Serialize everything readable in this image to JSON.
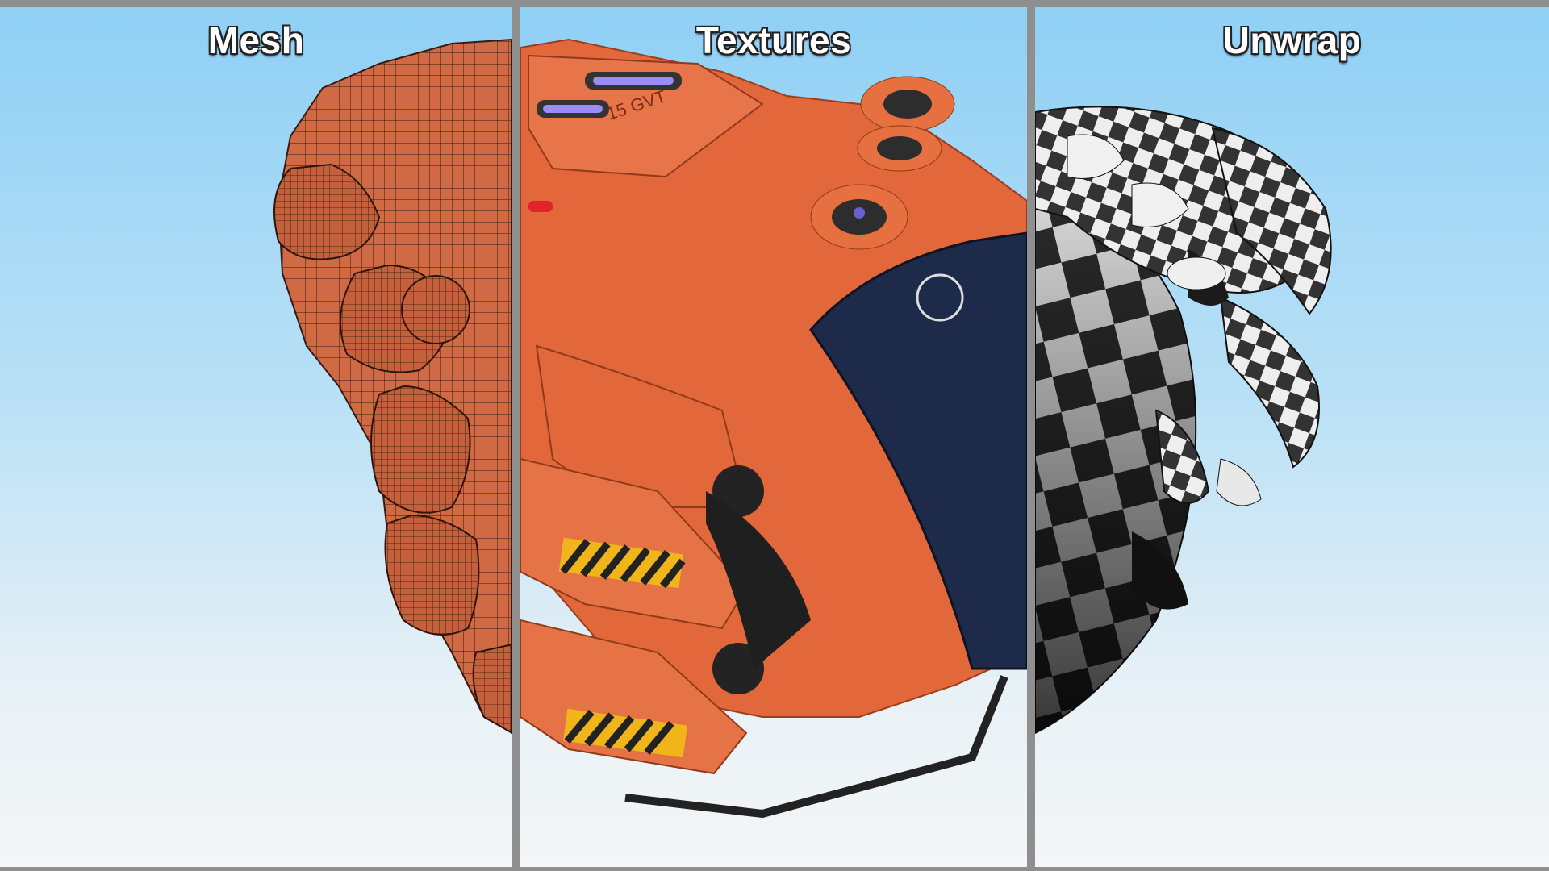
{
  "panels": [
    {
      "title": "Mesh"
    },
    {
      "title": "Textures"
    },
    {
      "title": "Unwrap"
    }
  ],
  "model_label": "15 GVT",
  "colors": {
    "frame": "#8f8f8f",
    "body_orange": "#e2683b",
    "mesh_orange": "#cf6a45",
    "hazard_yellow": "#f1b51c",
    "sky_top": "#8fd0f5",
    "sky_bottom": "#f4f6f7"
  }
}
